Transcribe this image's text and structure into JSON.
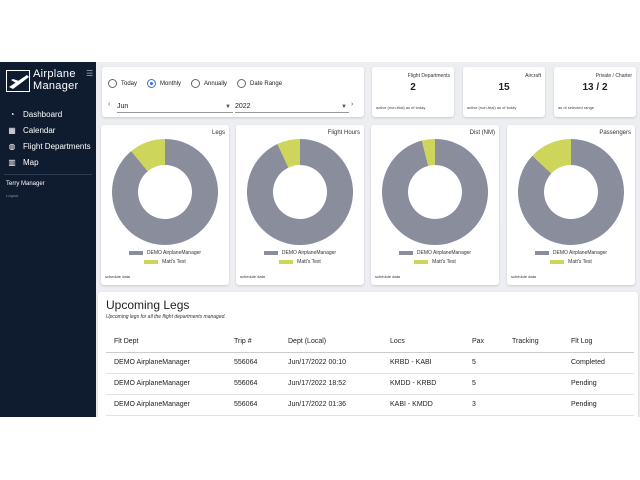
{
  "app": {
    "title_line1": "Airplane",
    "title_line2": "Manager",
    "menu_icon": "hamburger-icon"
  },
  "sidebar": {
    "items": [
      {
        "label": "Dashboard",
        "icon": "dashboard-icon"
      },
      {
        "label": "Calendar",
        "icon": "calendar-icon"
      },
      {
        "label": "Flight Departments",
        "icon": "globe-icon"
      },
      {
        "label": "Map",
        "icon": "map-icon"
      }
    ],
    "user_name": "Terry Manager",
    "logout_label": "Logout"
  },
  "filters": {
    "options": [
      "Today",
      "Monthly",
      "Annually",
      "Date Range"
    ],
    "selected": "Monthly",
    "month": "Jun",
    "year": "2022"
  },
  "stats": [
    {
      "title": "Flight Departments",
      "value": "2",
      "note": "active (non-trial) as of today"
    },
    {
      "title": "Aircraft",
      "value": "15",
      "note": "active (non-trial) as of today"
    },
    {
      "title": "Private / Charter",
      "value": "13 / 2",
      "note": "as of selected range"
    }
  ],
  "charts": [
    {
      "title": "Legs",
      "note": "schedule data",
      "values": {
        "DEMO AirplaneManager": 0.89,
        "Matt's Test": 0.11
      }
    },
    {
      "title": "Flight Hours",
      "note": "schedule data",
      "values": {
        "DEMO AirplaneManager": 0.93,
        "Matt's Test": 0.07
      }
    },
    {
      "title": "Dist (NM)",
      "note": "schedule data",
      "values": {
        "DEMO AirplaneManager": 0.96,
        "Matt's Test": 0.04
      }
    },
    {
      "title": "Passengers",
      "note": "schedule data",
      "values": {
        "DEMO AirplaneManager": 0.87,
        "Matt's Test": 0.13
      }
    }
  ],
  "legend": [
    {
      "label": "DEMO AirplaneManager",
      "color": "#8a8d9c"
    },
    {
      "label": "Matt's Test",
      "color": "#cdd65a"
    }
  ],
  "upcoming": {
    "title": "Upcoming Legs",
    "subtitle": "Upcoming legs for all the flight departments managed.",
    "columns": [
      "Flt Dept",
      "Trip #",
      "Dept (Local)",
      "Locs",
      "Pax",
      "Tracking",
      "Flt Log"
    ],
    "rows": [
      [
        "DEMO AirplaneManager",
        "556064",
        "Jun/17/2022 00:10",
        "KRBD - KABI",
        "5",
        "",
        "Completed"
      ],
      [
        "DEMO AirplaneManager",
        "556064",
        "Jun/17/2022 18:52",
        "KMDD - KRBD",
        "5",
        "",
        "Pending"
      ],
      [
        "DEMO AirplaneManager",
        "556064",
        "Jun/17/2022 01:36",
        "KABI - KMDD",
        "3",
        "",
        "Pending"
      ]
    ]
  }
}
